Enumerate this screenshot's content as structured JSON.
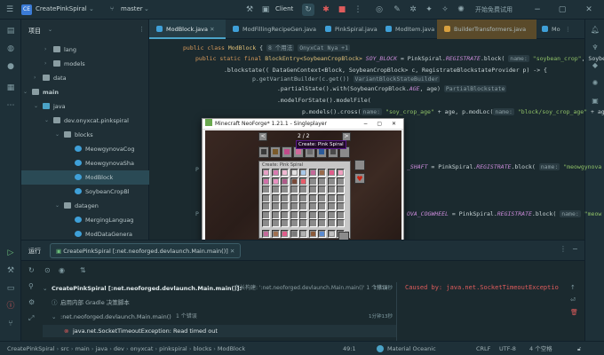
{
  "titlebar": {
    "project_badge": "CE",
    "project_name": "CreatePinkSpiral",
    "branch": "master",
    "run_config": "Client",
    "promo_text": "开始免费试用"
  },
  "project_panel": {
    "title": "项目",
    "items": [
      {
        "label": "lang",
        "indent": 3,
        "kind": "folder"
      },
      {
        "label": "models",
        "indent": 3,
        "kind": "folder"
      },
      {
        "label": "data",
        "indent": 2,
        "kind": "folder"
      },
      {
        "label": "main",
        "indent": 1,
        "kind": "module"
      },
      {
        "label": "java",
        "indent": 2,
        "kind": "source"
      },
      {
        "label": "dev.onyxcat.pinkspiral",
        "indent": 3,
        "kind": "package"
      },
      {
        "label": "blocks",
        "indent": 4,
        "kind": "package"
      },
      {
        "label": "MeowgynovaCog",
        "indent": 5,
        "kind": "java"
      },
      {
        "label": "MeowgynovaSha",
        "indent": 5,
        "kind": "java"
      },
      {
        "label": "ModBlock",
        "indent": 5,
        "kind": "java",
        "selected": true
      },
      {
        "label": "SoybeanCropBl",
        "indent": 5,
        "kind": "java"
      },
      {
        "label": "datagen",
        "indent": 4,
        "kind": "package"
      },
      {
        "label": "MergingLanguag",
        "indent": 5,
        "kind": "java"
      },
      {
        "label": "ModDataGenera",
        "indent": 5,
        "kind": "java"
      }
    ]
  },
  "editor_tabs": [
    {
      "label": "ModBlock.java",
      "active": true
    },
    {
      "label": "ModFillingRecipeGen.java"
    },
    {
      "label": "PinkSpiral.java"
    },
    {
      "label": "ModItem.java"
    },
    {
      "label": "BuilderTransformers.java",
      "warn": true
    },
    {
      "label": "Mo"
    }
  ],
  "code": {
    "line1_kw": "public class",
    "line1_cls": "ModBlock",
    "line1_brace": "{",
    "line1_hint1": "8 个用法",
    "line1_hint2": "OnyxCat Nya +1",
    "line2_kw": "public static final",
    "line2_type": "BlockEntry<SoybeanCropBlock>",
    "line2_field": "SOY_BLOCK",
    "line2_rest": "= PinkSpiral.",
    "line2_reg": "REGISTRATE",
    "line2_call": ".block(",
    "line2_hint": "name:",
    "line2_str": "\"soybean_crop\"",
    "line2_tail": ", Soybea",
    "line3": ".blockstate(( DataGenContext<Block, SoybeanCropBlock> c, RegistrateBlockstateProvider p) -> {",
    "line4": "p.getVariantBuilder(c.get())",
    "line4_hint": "VariantBlockStateBuilder",
    "line5": ".partialState().with(SoybeanCropBlock.",
    "line5_field": "AGE",
    "line5_rest": ", age)",
    "line5_hint": "PartialBlockstate",
    "line6": ".modelForState().modelFile(",
    "line7": "p.models().cross(",
    "line7_hint": "name:",
    "line7_str": "\"soy_crop_age\"",
    "line7_mid": " + age, p.modLoc(",
    "line7_hint2": "name:",
    "line7_str2": "\"block/soy_crop_age\"",
    "line7_tail": " + ag",
    "line8_field": "_SHAFT",
    "line8_rest": "= PinkSpiral.",
    "line8_reg": "REGISTRATE",
    "line8_call": ".block(",
    "line8_hint": "name:",
    "line8_str": "\"meowgynova",
    "line9_field": "OVA_COGWHEEL",
    "line9_rest": "= PinkSpiral.",
    "line9_reg": "REGISTRATE",
    "line9_call": ".block(",
    "line9_hint": "name:",
    "line9_str": "\"meow"
  },
  "minecraft": {
    "title": "Minecraft NeoForge* 1.21.1 - Singleplayer",
    "page": "2 / 2",
    "tooltip": "Create: Pink Spiral",
    "inventory_label": "Create: Pink Spiral"
  },
  "run_panel": {
    "label": "运行",
    "tab": "CreatePinkSpiral [:net.neoforged.devlaunch.Main.main()]"
  },
  "console": {
    "tree": [
      {
        "text": "CreatePinkSpiral [:net.neoforged.devlaunch.Main.main()]:",
        "suffix": "在长构建: ':net.neoforged.devlaunch.Main.main()' 1 个错误",
        "time": "1分19秒"
      },
      {
        "text": "启用内部 Gradle 决策脚本",
        "time": ""
      },
      {
        "text": ":net.neoforged.devlaunch.Main.main()",
        "suffix": "1 个错误",
        "time": "1分钟13秒"
      },
      {
        "text": "java.net.SocketTimeoutException: Read timed out",
        "time": ""
      }
    ],
    "error": "Caused by: java.net.SocketTimeoutExceptio"
  },
  "status_bar": {
    "breadcrumb": [
      "CreatePinkSpiral",
      "src",
      "main",
      "java",
      "dev",
      "onyxcat",
      "pinkspiral",
      "blocks",
      "ModBlock"
    ],
    "position": "49:1",
    "theme": "Material Oceanic",
    "line_ending": "CRLF",
    "encoding": "UTF-8",
    "indent": "4 个空格"
  },
  "colors": {
    "accent": "#4ba3c7",
    "keyword": "#d89a5a",
    "string": "#8fc067",
    "field": "#c98ad8",
    "error": "#e05c5c"
  }
}
